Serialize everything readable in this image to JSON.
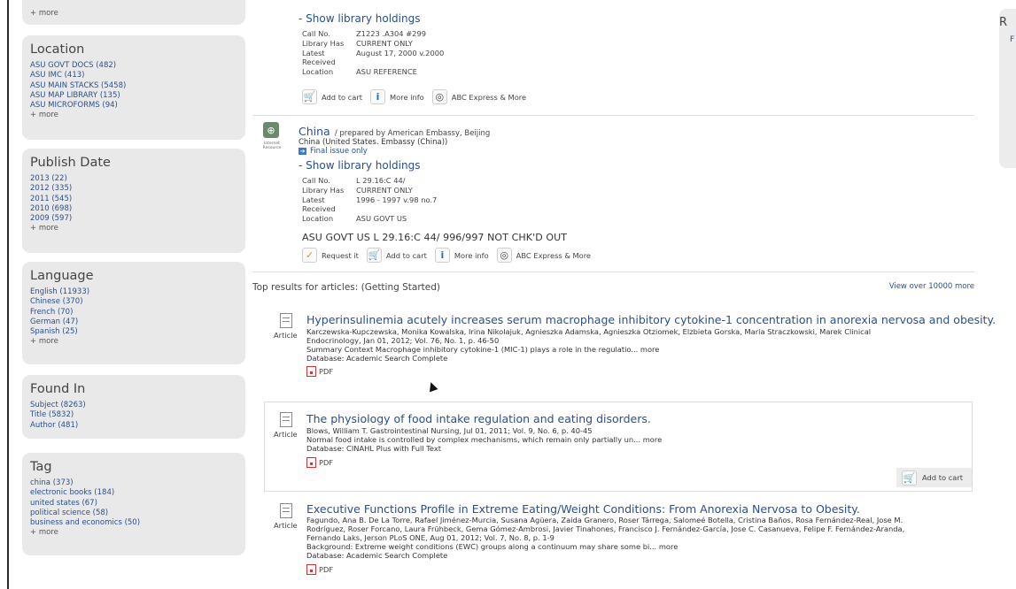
{
  "sidebar": {
    "top_more": "+ more",
    "facets": [
      {
        "title": "Location",
        "items": [
          "ASU GOVT DOCS (482)",
          "ASU IMC (413)",
          "ASU MAIN STACKS (5458)",
          "ASU MAP LIBRARY (135)",
          "ASU MICROFORMS (94)"
        ],
        "more": "+ more"
      },
      {
        "title": "Publish Date",
        "items": [
          "2013 (22)",
          "2012 (335)",
          "2011 (545)",
          "2010 (698)",
          "2009 (597)"
        ],
        "more": "+ more"
      },
      {
        "title": "Language",
        "items": [
          "English (11933)",
          "Chinese (370)",
          "French (70)",
          "German (47)",
          "Spanish (25)"
        ],
        "more": "+ more"
      },
      {
        "title": "Found In",
        "items": [
          "Subject (8263)",
          "Title (5832)",
          "Author (481)"
        ],
        "more": ""
      },
      {
        "title": "Tag",
        "items": [
          "china (373)",
          "electronic books (184)",
          "united states (67)",
          "political science (58)",
          "business and economics (50)"
        ],
        "more": "+ more"
      }
    ]
  },
  "right_panel": {
    "letter": "R",
    "link": "F"
  },
  "record1": {
    "show_holdings": "- Show library holdings",
    "holdings": [
      {
        "k": "Call No.",
        "v": "Z1223 .A304 #299"
      },
      {
        "k": "Library Has",
        "v": "CURRENT ONLY"
      },
      {
        "k": "Latest Received",
        "v": "August 17, 2000 v.2000"
      },
      {
        "k": "Location",
        "v": "ASU REFERENCE"
      }
    ],
    "buttons": [
      "Add to cart",
      "More info",
      "ABC Express & More"
    ]
  },
  "record2": {
    "icon_label": "Internet Resource",
    "title": "China",
    "by": "/ prepared by American Embassy, Beijing",
    "author": "China (United States. Embassy (China))",
    "final_issue": "Final issue only",
    "show_holdings": "- Show library holdings",
    "holdings": [
      {
        "k": "Call No.",
        "v": "L 29.16:C 44/"
      },
      {
        "k": "Library Has",
        "v": "CURRENT ONLY"
      },
      {
        "k": "Latest Received",
        "v": "1996 - 1997 v.98 no.7"
      },
      {
        "k": "Location",
        "v": "ASU GOVT US"
      }
    ],
    "call_line": "ASU GOVT US L 29.16:C 44/ 996/997  NOT CHK'D OUT",
    "buttons": [
      "Request it",
      "Add to cart",
      "More info",
      "ABC Express & More"
    ]
  },
  "articles_section": {
    "heading": "Top results for articles: (Getting Started)",
    "view_more": "View over 10000 more",
    "items": [
      {
        "type": "Article",
        "title": "Hyperinsulinemia acutely increases serum macrophage inhibitory cytokine-1 concentration in anorexia nervosa and obesity.",
        "authors": "Karczewska-Kupczewska, Monika Kowalska, Irina Nikolajuk, Agnieszka Adamska, Agnieszka Otziomek, Elzbieta Gorska, Maria Straczkowski, Marek Clinical",
        "source": "Endocrinology, Jan 01, 2012; Vol. 76, No. 1, p. 46-50",
        "summary": "Summary Context Macrophage inhibitory cytokine-1 (MIC-1) plays a role in the regulatio... more",
        "database": "Database: Academic Search Complete",
        "pdf": "PDF"
      },
      {
        "type": "Article",
        "title": "The physiology of food intake regulation and eating disorders.",
        "authors": "Blows, William T. Gastrointestinal Nursing, Jul 01, 2011; Vol. 9, No. 6, p. 40-45",
        "summary": "Normal food intake is controlled by complex mechanisms, which remain only partially un... more",
        "database": "Database: CINAHL Plus with Full Text",
        "pdf": "PDF",
        "cart": "Add to cart"
      },
      {
        "type": "Article",
        "title": "Executive Functions Profile in Extreme Eating/Weight Conditions: From Anorexia Nervosa to Obesity.",
        "authors1": "Fagundo, Ana B. De La Torre, Rafael Jiménez-Murcia, Susana Agüera, Zaida Granero, Roser Tárrega, Salomeé Botella, Cristina Baños, Rosa Fernández-Real, Jose M.",
        "authors2": "Rodríguez, Roser Forcano, Laura Frühbeck, Gema Gómez-Ambrosi, Javier Tinahones, Francisco J. Fernández-García, Jose C. Casanueva, Felipe F. Fernández-Aranda,",
        "authors3": "Fernando Laks, Jerson PLoS ONE, Aug 01, 2012; Vol. 7, No. 8, p. 1-9",
        "summary": "Background: Extreme weight conditions (EWC) groups along a continuum may share some bi... more",
        "database": "Database: Academic Search Complete",
        "pdf": "PDF"
      }
    ]
  }
}
